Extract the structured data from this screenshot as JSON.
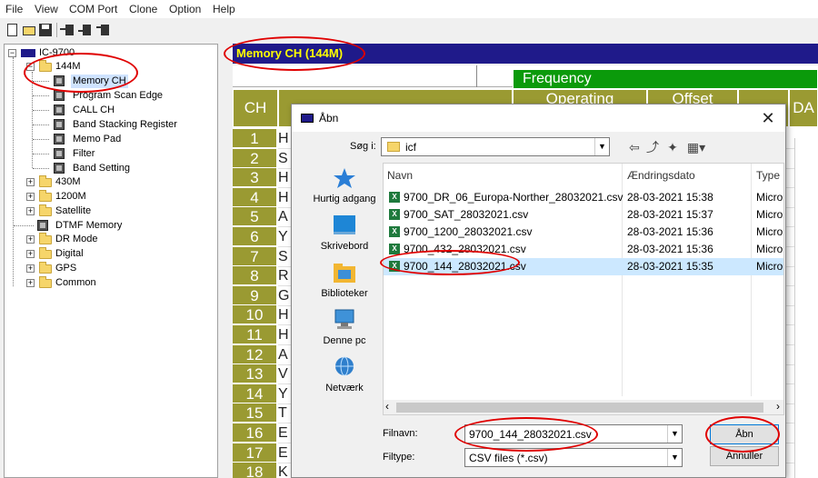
{
  "menu": [
    "File",
    "View",
    "COM Port",
    "Clone",
    "Option",
    "Help"
  ],
  "tree": {
    "root": "IC-9700",
    "band_144": "144M",
    "items_144": [
      "Memory CH",
      "Program Scan Edge",
      "CALL CH",
      "Band Stacking Register",
      "Memo Pad",
      "Filter",
      "Band Setting"
    ],
    "other": [
      "430M",
      "1200M",
      "Satellite",
      "DTMF Memory",
      "DR Mode",
      "Digital",
      "GPS",
      "Common"
    ]
  },
  "panel": {
    "title": "Memory CH (144M)",
    "header_ch": "CH",
    "header_frequency": "Frequency",
    "header_operating": "Operating",
    "header_offset": "Offset",
    "header_da": "DA",
    "rows": [
      {
        "ch": "1",
        "frag": "H"
      },
      {
        "ch": "2",
        "frag": "S"
      },
      {
        "ch": "3",
        "frag": "H"
      },
      {
        "ch": "4",
        "frag": "H"
      },
      {
        "ch": "5",
        "frag": "A"
      },
      {
        "ch": "6",
        "frag": "Y"
      },
      {
        "ch": "7",
        "frag": "S"
      },
      {
        "ch": "8",
        "frag": "R"
      },
      {
        "ch": "9",
        "frag": "G"
      },
      {
        "ch": "10",
        "frag": "H"
      },
      {
        "ch": "11",
        "frag": "H"
      },
      {
        "ch": "12",
        "frag": "A"
      },
      {
        "ch": "13",
        "frag": "V"
      },
      {
        "ch": "14",
        "frag": "Y"
      },
      {
        "ch": "15",
        "frag": "T"
      },
      {
        "ch": "16",
        "frag": "E"
      },
      {
        "ch": "17",
        "frag": "E"
      },
      {
        "ch": "18",
        "frag": "K"
      }
    ]
  },
  "dialog": {
    "title": "Åbn",
    "close": "✕",
    "look_in_label": "Søg i:",
    "look_in_value": "icf",
    "places": [
      "Hurtig adgang",
      "Skrivebord",
      "Biblioteker",
      "Denne pc",
      "Netværk"
    ],
    "columns": {
      "name": "Navn",
      "date": "Ændringsdato",
      "type": "Type"
    },
    "files": [
      {
        "name": "9700_DR_06_Europa-Norther_28032021.csv",
        "date": "28-03-2021 15:38",
        "type": "Micro"
      },
      {
        "name": "9700_SAT_28032021.csv",
        "date": "28-03-2021 15:37",
        "type": "Micro"
      },
      {
        "name": "9700_1200_28032021.csv",
        "date": "28-03-2021 15:36",
        "type": "Micro"
      },
      {
        "name": "9700_432_28032021.csv",
        "date": "28-03-2021 15:36",
        "type": "Micro"
      },
      {
        "name": "9700_144_28032021.csv",
        "date": "28-03-2021 15:35",
        "type": "Micro"
      }
    ],
    "selected_index": 4,
    "filename_label": "Filnavn:",
    "filename_value": "9700_144_28032021.csv",
    "filetype_label": "Filtype:",
    "filetype_value": "CSV files (*.csv)",
    "open_button": "Åbn",
    "cancel_button": "Annuller"
  },
  "colors": {
    "accent_red": "#e00000",
    "panel_title_bg": "#1f1a8a",
    "panel_title_fg": "#ffff00",
    "header_olive": "#9a9a32",
    "header_green": "#0b9a0b",
    "selection": "#cce8ff"
  }
}
